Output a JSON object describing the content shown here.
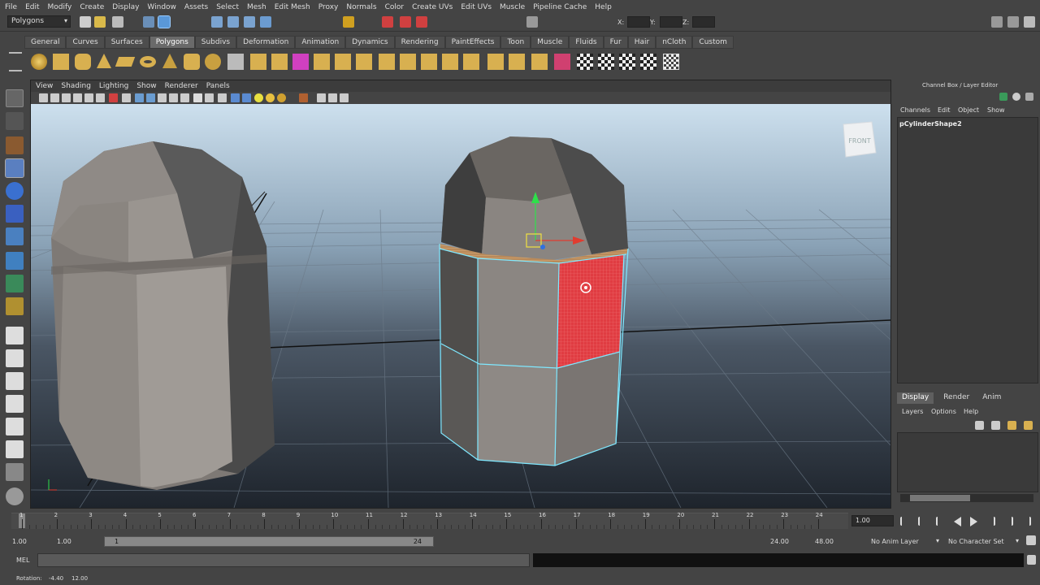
{
  "menus": [
    "File",
    "Edit",
    "Modify",
    "Create",
    "Display",
    "Window",
    "Assets",
    "Select",
    "Mesh",
    "Edit Mesh",
    "Proxy",
    "Normals",
    "Color",
    "Create UVs",
    "Edit UVs",
    "Muscle",
    "Pipeline Cache",
    "Help"
  ],
  "status_line": {
    "mode": "Polygons",
    "x_label": "X:",
    "y_label": "Y:",
    "z_label": "Z:"
  },
  "shelf_tabs": [
    "General",
    "Curves",
    "Surfaces",
    "Polygons",
    "Subdivs",
    "Deformation",
    "Animation",
    "Dynamics",
    "Rendering",
    "PaintEffects",
    "Toon",
    "Muscle",
    "Fluids",
    "Fur",
    "Hair",
    "nCloth",
    "Custom"
  ],
  "active_shelf_tab": "Polygons",
  "panel_menu": [
    "View",
    "Shading",
    "Lighting",
    "Show",
    "Renderer",
    "Panels"
  ],
  "view_cube_label": "FRONT",
  "channel_box": {
    "title": "Channel Box / Layer Editor",
    "menu": [
      "Channels",
      "Edit",
      "Object",
      "Show"
    ],
    "object_name": "pCylinderShape2"
  },
  "layer_editor": {
    "tabs": [
      "Display",
      "Render",
      "Anim"
    ],
    "active_tab": "Display",
    "menu": [
      "Layers",
      "Options",
      "Help"
    ]
  },
  "timeline": {
    "ticks": [
      "1",
      "2",
      "3",
      "4",
      "5",
      "6",
      "7",
      "8",
      "9",
      "10",
      "11",
      "12",
      "13",
      "14",
      "15",
      "16",
      "17",
      "18",
      "19",
      "20",
      "21",
      "22",
      "23",
      "24"
    ],
    "current_frame": "1.00"
  },
  "range_slider": {
    "start_time": "1.00",
    "playback_start": "1.00",
    "range_start_label": "1",
    "range_end_label": "24",
    "playback_end": "24.00",
    "end_time": "48.00",
    "anim_layer": "No Anim Layer",
    "character_set": "No Character Set"
  },
  "command_line": {
    "label": "MEL"
  },
  "help_line": {
    "label": "Rotation:",
    "value1": "-4.40",
    "value2": "12.00"
  },
  "colors": {
    "selection": "#7fe8ff",
    "face_highlight": "#e0333a",
    "bg_sky": "#c9dbe8",
    "bg_ground": "#2a3038"
  }
}
